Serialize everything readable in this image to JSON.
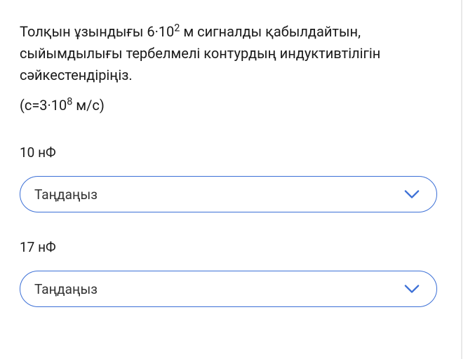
{
  "question": {
    "line1_pre": "Толқын ұзындығы 6·10",
    "line1_sup": "2",
    "line1_post": " м сигналды қабылдайтын, сыйымдылығы тербелмелі контурдың индуктивтілігін сәйкестендіріңіз.",
    "line2_pre": "(c=3·10",
    "line2_sup": "8",
    "line2_post": " м/с)"
  },
  "options": [
    {
      "label": "10 нФ",
      "placeholder": "Таңдаңыз"
    },
    {
      "label": "17 нФ",
      "placeholder": "Таңдаңыз"
    }
  ]
}
